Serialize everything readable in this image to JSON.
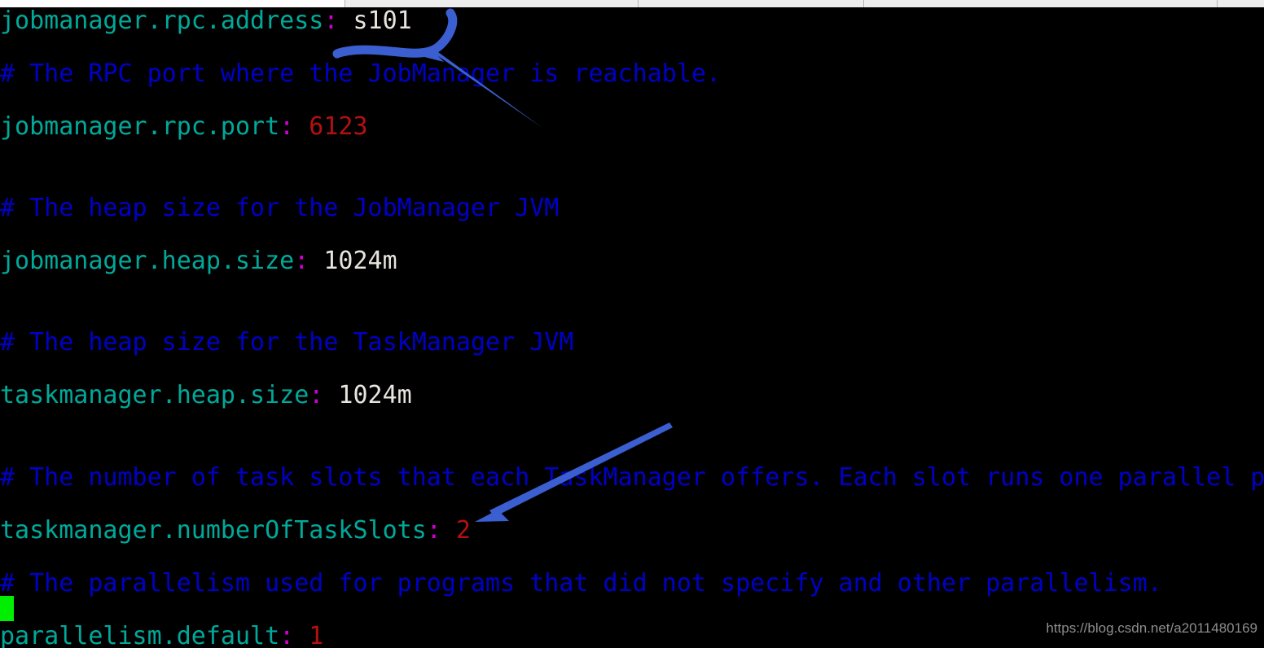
{
  "window": {
    "chrome_strip_present": true
  },
  "terminal": {
    "background_color": "#000000",
    "comment_color": "#0000c8",
    "key_color": "#00a99a",
    "colon_color": "#cf00cf",
    "string_value_color": "#e8e4de",
    "number_value_color": "#b51010",
    "cursor_color": "#00ee00",
    "lines": [
      {
        "type": "setting",
        "key": "jobmanager.rpc.address",
        "colon": ":",
        "value": " s101",
        "value_kind": "string"
      },
      {
        "type": "comment",
        "text": "# The RPC port where the JobManager is reachable."
      },
      {
        "type": "setting",
        "key": "jobmanager.rpc.port",
        "colon": ":",
        "value": " 6123",
        "value_kind": "number"
      },
      {
        "type": "comment",
        "text": "# The heap size for the JobManager JVM"
      },
      {
        "type": "setting",
        "key": "jobmanager.heap.size",
        "colon": ":",
        "value": " 1024m",
        "value_kind": "string"
      },
      {
        "type": "comment",
        "text": "# The heap size for the TaskManager JVM"
      },
      {
        "type": "setting",
        "key": "taskmanager.heap.size",
        "colon": ":",
        "value": " 1024m",
        "value_kind": "string"
      },
      {
        "type": "comment",
        "text": "# The number of task slots that each TaskManager offers. Each slot runs one parallel p"
      },
      {
        "type": "setting",
        "key": "taskmanager.numberOfTaskSlots",
        "colon": ":",
        "value": " 2",
        "value_kind": "number"
      },
      {
        "type": "comment",
        "text": "# The parallelism used for programs that did not specify and other parallelism."
      },
      {
        "type": "setting",
        "key": "parallelism.default",
        "colon": ":",
        "value": " 1",
        "value_kind": "number"
      }
    ]
  },
  "annotations": {
    "arrow_color": "#3b5fd0",
    "items": [
      {
        "name": "arrow-to-jobmanager-rpc-address",
        "points_at": "s101"
      },
      {
        "name": "arrow-to-numberoftaskslots",
        "points_at": "2"
      }
    ]
  },
  "watermark": {
    "text": "https://blog.csdn.net/a2011480169"
  }
}
